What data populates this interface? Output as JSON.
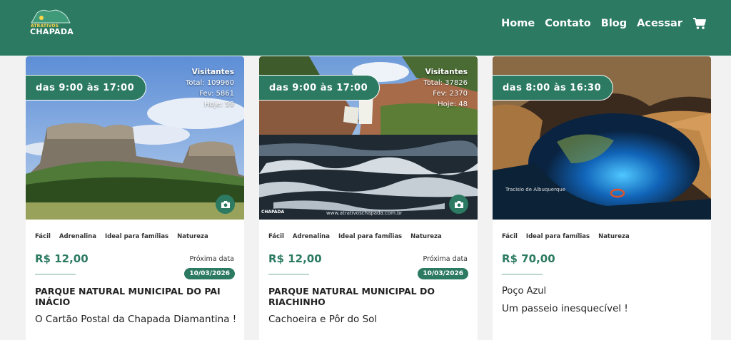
{
  "brand": {
    "top": "ATRATIVOS",
    "name": "CHAPADA"
  },
  "nav": {
    "home": "Home",
    "contact": "Contato",
    "blog": "Blog",
    "login": "Acessar"
  },
  "cards": [
    {
      "hours": "das 9:00 às 17:00",
      "visitors": {
        "title": "Visitantes",
        "total": "Total: 109960",
        "month": "Fev: 5861",
        "today": "Hoje: 59"
      },
      "tags": [
        "Fácil",
        "Adrenalina",
        "Ideal para famílias",
        "Natureza"
      ],
      "price": "R$ 12,00",
      "next_label": "Próxima data",
      "next_date": "10/03/2026",
      "title": "PARQUE NATURAL MUNICIPAL DO PAI INÁCIO",
      "subtitle": "O Cartão Postal da Chapada Diamantina !"
    },
    {
      "hours": "das 9:00 às 17:00",
      "visitors": {
        "title": "Visitantes",
        "total": "Total: 37826",
        "month": "Fev: 2370",
        "today": "Hoje: 48"
      },
      "tags": [
        "Fácil",
        "Adrenalina",
        "Ideal para famílias",
        "Natureza"
      ],
      "price": "R$ 12,00",
      "next_label": "Próxima data",
      "next_date": "10/03/2026",
      "title": "PARQUE NATURAL MUNICIPAL DO RIACHINHO",
      "subtitle": "Cachoeira e Pôr do Sol",
      "watermark": "www.atrativoschapada.com.br",
      "logo_tag": "CHAPADA"
    },
    {
      "hours": "das 8:00 às 16:30",
      "tags": [
        "Fácil",
        "Ideal para famílias",
        "Natureza"
      ],
      "price": "R$ 70,00",
      "title": "Poço Azul",
      "subtitle": "Um passeio inesquecível !",
      "credit": "Tracisio de Albuquerque"
    }
  ],
  "colors": {
    "brand_green": "#2b7a61",
    "badge_green": "#2b7a61"
  },
  "icons": [
    "cart-icon",
    "camera-icon",
    "logo-icon"
  ]
}
